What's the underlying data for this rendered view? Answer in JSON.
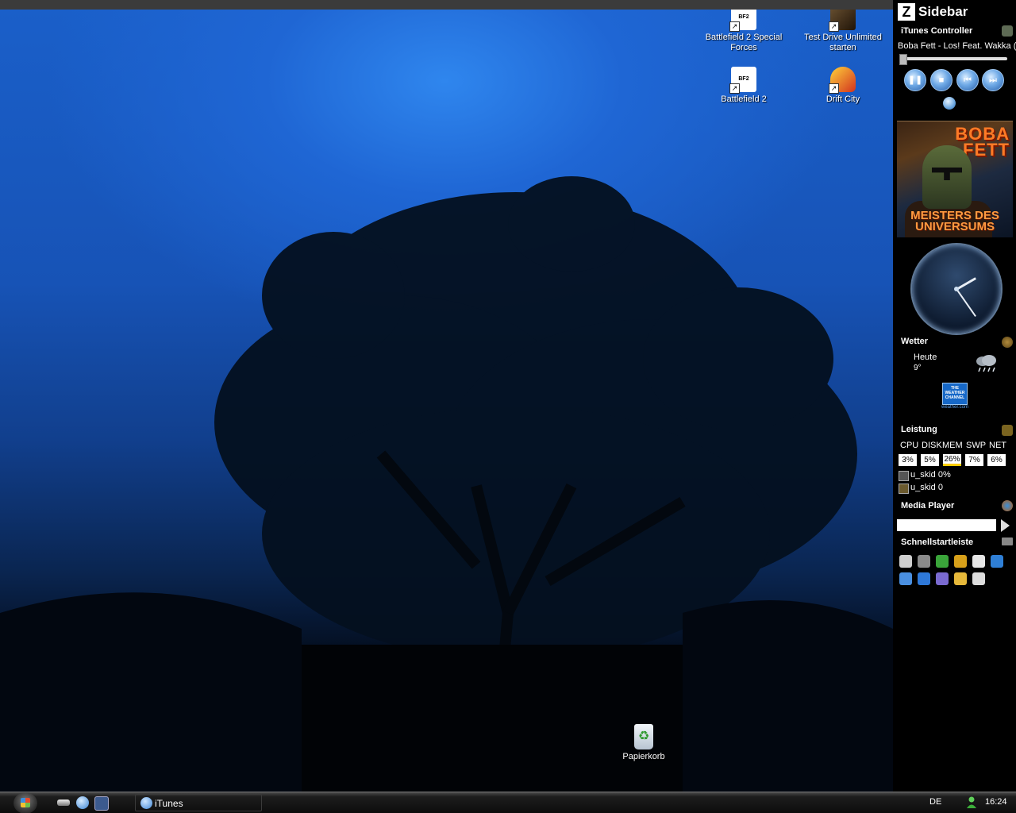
{
  "desktop": {
    "icons": [
      {
        "label": "Battlefield 2 Special Forces",
        "icon": "battlefield-2-sf-icon"
      },
      {
        "label": "Test Drive Unlimited starten",
        "icon": "test-drive-unlimited-icon"
      },
      {
        "label": "Battlefield 2",
        "icon": "battlefield-2-icon"
      },
      {
        "label": "Drift City",
        "icon": "drift-city-icon"
      },
      {
        "label": "Papierkorb",
        "icon": "recycle-bin-icon"
      }
    ]
  },
  "sidebar": {
    "title": "Sidebar",
    "itunes": {
      "title": "iTunes Controller",
      "track": "Boba Fett - Los! Feat. Wakka (Remix)",
      "album_art": {
        "top_text": "BOBA FETT",
        "bottom_text": "MEISTERS DES UNIVERSUMS"
      },
      "buttons": [
        {
          "name": "pause",
          "glyph": "❚❚"
        },
        {
          "name": "stop",
          "glyph": "■"
        },
        {
          "name": "previous",
          "glyph": "⏮"
        },
        {
          "name": "next",
          "glyph": "⏭"
        }
      ]
    },
    "clock": {
      "hour_angle": 60,
      "minute_angle": 145
    },
    "weather": {
      "title": "Wetter",
      "day": "Heute",
      "temp": "9°",
      "logo_text": "THE WEATHER CHANNEL",
      "url": "weather.com"
    },
    "performance": {
      "title": "Leistung",
      "headers": [
        "CPU",
        "DISK",
        "MEM",
        "SWP",
        "NET"
      ],
      "values": [
        "3%",
        "5%",
        "26%",
        "7%",
        "6%"
      ],
      "process1": "u_skid 0%",
      "process2": "u_skid 0"
    },
    "media_player": {
      "title": "Media Player"
    },
    "quicklaunch": {
      "title": "Schnellstartleiste",
      "icons": [
        "show-desktop-icon",
        "rocket-icon",
        "info-icon",
        "bat-icon",
        "link-icon",
        "internet-explorer-icon",
        "itunes-icon",
        "quicktime-icon",
        "headphones-icon",
        "media-player-icon",
        "window-icon"
      ]
    }
  },
  "taskbar": {
    "task_label": "iTunes",
    "language": "DE",
    "time": "16:24"
  },
  "colors": {
    "desktop_blue": "#1a5fc9",
    "sidebar_bg": "#000000",
    "accent": "#ff7a26"
  }
}
